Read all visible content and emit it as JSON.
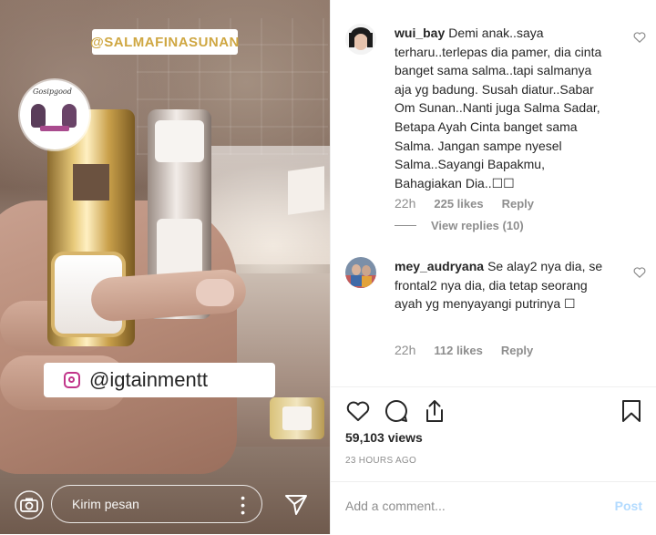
{
  "media": {
    "top_tag": "@SALMAFINASUNAN",
    "badge_text": "Gosipgood",
    "ig_tag": "@igtainmentt",
    "reply_placeholder": "Kirim pesan",
    "icons": [
      "camera-icon",
      "more-vertical-icon",
      "send-icon",
      "instagram-icon"
    ]
  },
  "comments": [
    {
      "username": "wui_bay",
      "text": "Demi anak..saya terharu..terlepas dia pamer, dia cinta banget sama salma..tapi salmanya aja yg badung. Susah diatur..Sabar Om Sunan..Nanti juga Salma Sadar, Betapa Ayah Cinta banget sama Salma. Jangan sampe nyesel Salma..Sayangi Bapakmu, Bahagiakan Dia..☐☐",
      "time": "22h",
      "likes": "225 likes",
      "reply_label": "Reply",
      "view_replies": "View replies (10)"
    },
    {
      "username": "mey_audryana",
      "text": "Se alay2 nya dia, se frontal2 nya dia, dia tetap seorang ayah yg menyayangi putrinya ☐",
      "time": "22h",
      "likes": "112 likes",
      "reply_label": "Reply"
    }
  ],
  "post": {
    "views": "59,103 views",
    "time_ago": "23 HOURS AGO",
    "add_comment_placeholder": "Add a comment...",
    "post_label": "Post"
  },
  "colors": {
    "top_tag_text": "#cfa742",
    "post_disabled": "#b3dbff",
    "meta_gray": "#8e8e8e",
    "text": "#262626"
  }
}
